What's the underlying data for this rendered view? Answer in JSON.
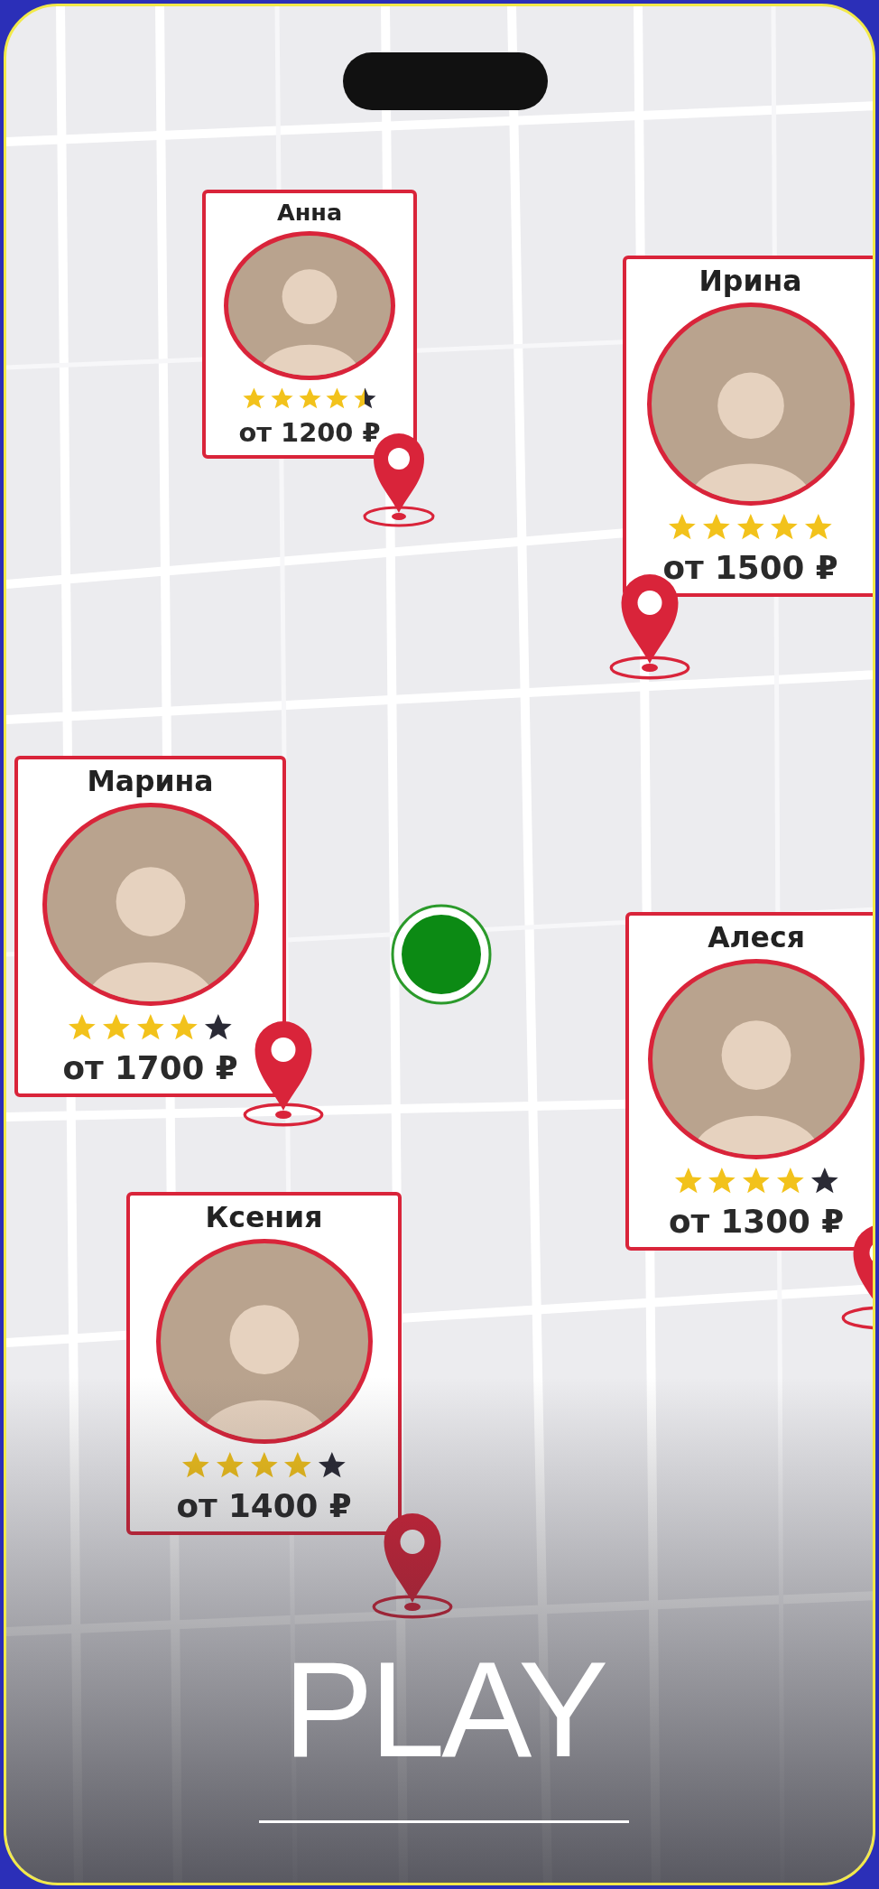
{
  "profiles": [
    {
      "name": "Анна",
      "stars": 4.5,
      "price": "от 1200 ₽"
    },
    {
      "name": "Ирина",
      "stars": 5,
      "price": "от 1500 ₽"
    },
    {
      "name": "Марина",
      "stars": 4,
      "price": "от 1700 ₽"
    },
    {
      "name": "Алеся",
      "stars": 4,
      "price": "от 1300 ₽"
    },
    {
      "name": "Ксения",
      "stars": 4,
      "price": "от 1400 ₽"
    }
  ],
  "play_button": {
    "label": "PLAY"
  }
}
